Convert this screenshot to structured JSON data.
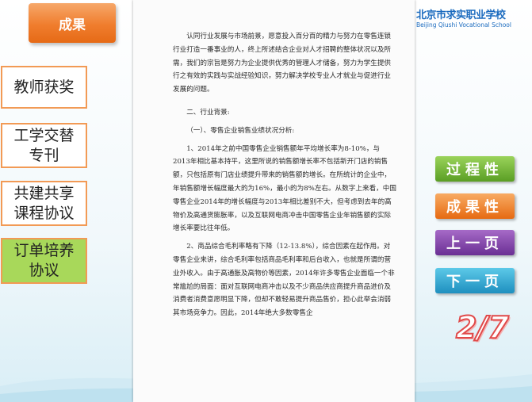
{
  "top_button": {
    "label": "成果"
  },
  "nav": [
    {
      "label": "教师获奖"
    },
    {
      "label": "工学交替\n专刊"
    },
    {
      "label": "共建共享\n课程协议"
    },
    {
      "label": "订单培养\n协议"
    }
  ],
  "logo": {
    "cn": "北京市求实职业学校",
    "en": "Beijing Qiushi Vocational School"
  },
  "document": {
    "paragraphs": [
      "认同行业发展与市场前景，愿意投入百分百的精力与努力在零售连锁行业打造一番事业的人，终上所述结合企业对人才招聘的整体状况以及所需，我们的宗旨是努力为企业提供优秀的管理人才储备，努力为学生提供行之有效的实践与实战经验知识，努力解决学校专业人才就业与促进行业发展的问题。",
      "二、行业背景:",
      "（一）、零售企业销售业绩状况分析:",
      "1、2014年之前中国零售企业销售额年平均增长率为8-10%，与2013年相比基本持平，这里所说的销售额增长率不包括新开门店的销售额，只包括原有门店业绩提升带来的销售额的增长。在所统计的企业中，年销售额增长幅度最大的为16%，最小的为8%左右。从数字上来看，中国零售企业2014年的增长幅度与2013年相比差别不大，但考虑到去年的高物价及高通货膨胀率，以及互联网电商冲击中国零售企业年销售额的实际增长率要比往年低。",
      "2、商品综合毛利率略有下降（12-13.8%），综合因素在起作用。对零售企业来讲，综合毛利率包括商品毛利率和后台收入，也就是所谓的营业外收入。由于高通胀及高物价等因素，2014年许多零售企业面临一个非常尴尬的局面：面对互联网电商冲击以及不少商品供应商提升商品进价及消费者消费意愿明显下降，但却不敢轻易提升商品售价，担心此举会消弱其市场竞争力。因此，2014年绝大多数零售企"
    ]
  },
  "right_buttons": [
    {
      "label": "过程性"
    },
    {
      "label": "成果性"
    },
    {
      "label": "上一页"
    },
    {
      "label": "下一页"
    }
  ],
  "page_indicator": "2/7"
}
